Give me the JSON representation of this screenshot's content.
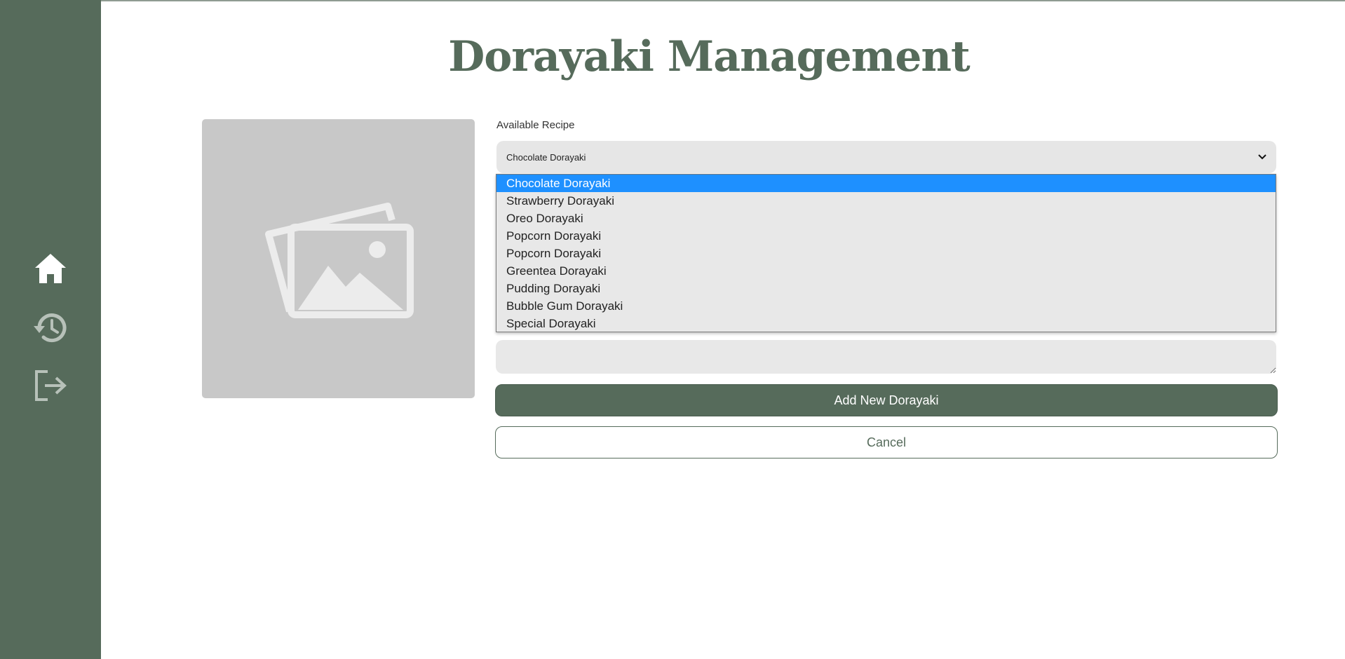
{
  "page": {
    "title": "Dorayaki Management"
  },
  "colors": {
    "sidebar": "#566b5b",
    "accent": "#566b5b",
    "selected_option": "#1e90ff",
    "field_background": "#e6e6e6",
    "placeholder_image": "#c8c8c8"
  },
  "sidebar": {
    "items": [
      {
        "icon": "home-icon",
        "active": true
      },
      {
        "icon": "history-icon",
        "active": false
      },
      {
        "icon": "logout-icon",
        "active": false
      }
    ]
  },
  "image_preview": {
    "icon": "image-placeholder-icon"
  },
  "form": {
    "recipe_label": "Available Recipe",
    "recipe_selected": "Chocolate Dorayaki",
    "recipe_options": [
      "Chocolate Dorayaki",
      "Strawberry Dorayaki",
      "Oreo Dorayaki",
      "Popcorn Dorayaki",
      "Popcorn Dorayaki",
      "Greentea Dorayaki",
      "Pudding Dorayaki",
      "Bubble Gum Dorayaki",
      "Special Dorayaki"
    ],
    "description_value": "",
    "submit_label": "Add New Dorayaki",
    "cancel_label": "Cancel"
  }
}
